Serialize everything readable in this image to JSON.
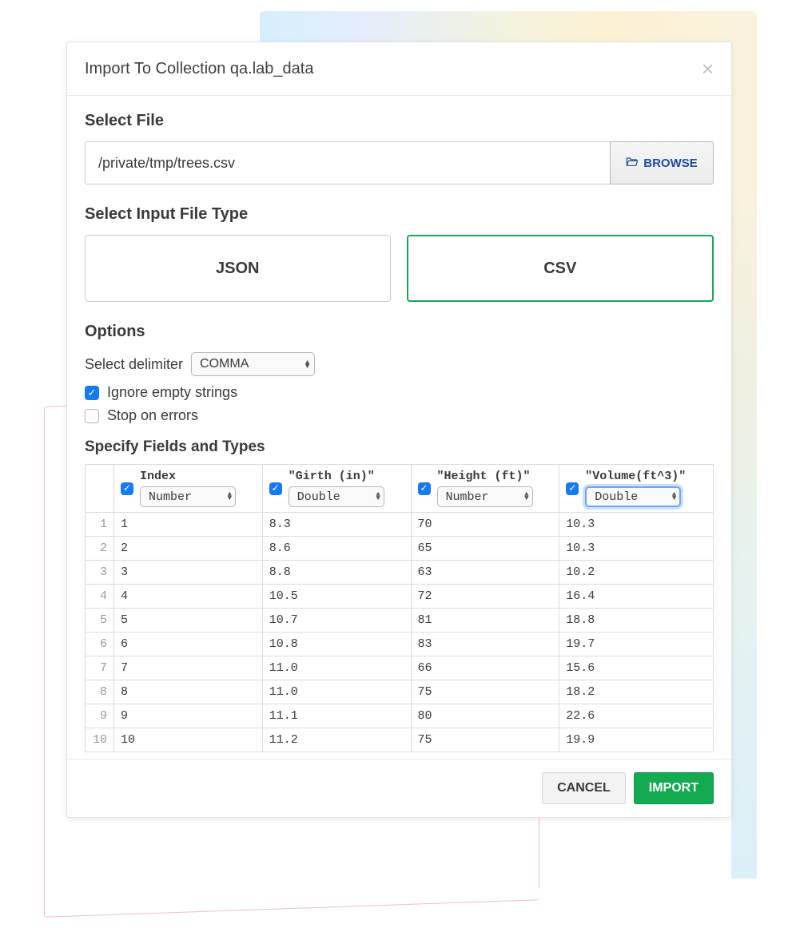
{
  "modal": {
    "title": "Import To Collection qa.lab_data",
    "select_file_heading": "Select File",
    "file_path": "/private/tmp/trees.csv",
    "browse_label": "BROWSE",
    "file_type_heading": "Select Input File Type",
    "file_types": {
      "json": "JSON",
      "csv": "CSV"
    },
    "options_heading": "Options",
    "delimiter_label": "Select delimiter",
    "delimiter_value": "COMMA",
    "ignore_empty_label": "Ignore empty strings",
    "stop_on_errors_label": "Stop on errors",
    "fields_heading": "Specify Fields and Types",
    "cancel_label": "CANCEL",
    "import_label": "IMPORT"
  },
  "columns": [
    {
      "name": "Index",
      "type": "Number",
      "checked": true
    },
    {
      "name": "\"Girth (in)\"",
      "type": "Double",
      "checked": true
    },
    {
      "name": "\"Height (ft)\"",
      "type": "Number",
      "checked": true
    },
    {
      "name": "\"Volume(ft^3)\"",
      "type": "Double",
      "checked": true,
      "highlight": true
    }
  ],
  "rows": [
    [
      "1",
      "1",
      "8.3",
      "70",
      "10.3"
    ],
    [
      "2",
      "2",
      "8.6",
      "65",
      "10.3"
    ],
    [
      "3",
      "3",
      "8.8",
      "63",
      "10.2"
    ],
    [
      "4",
      "4",
      "10.5",
      "72",
      "16.4"
    ],
    [
      "5",
      "5",
      "10.7",
      "81",
      "18.8"
    ],
    [
      "6",
      "6",
      "10.8",
      "83",
      "19.7"
    ],
    [
      "7",
      "7",
      "11.0",
      "66",
      "15.6"
    ],
    [
      "8",
      "8",
      "11.0",
      "75",
      "18.2"
    ],
    [
      "9",
      "9",
      "11.1",
      "80",
      "22.6"
    ],
    [
      "10",
      "10",
      "11.2",
      "75",
      "19.9"
    ]
  ]
}
